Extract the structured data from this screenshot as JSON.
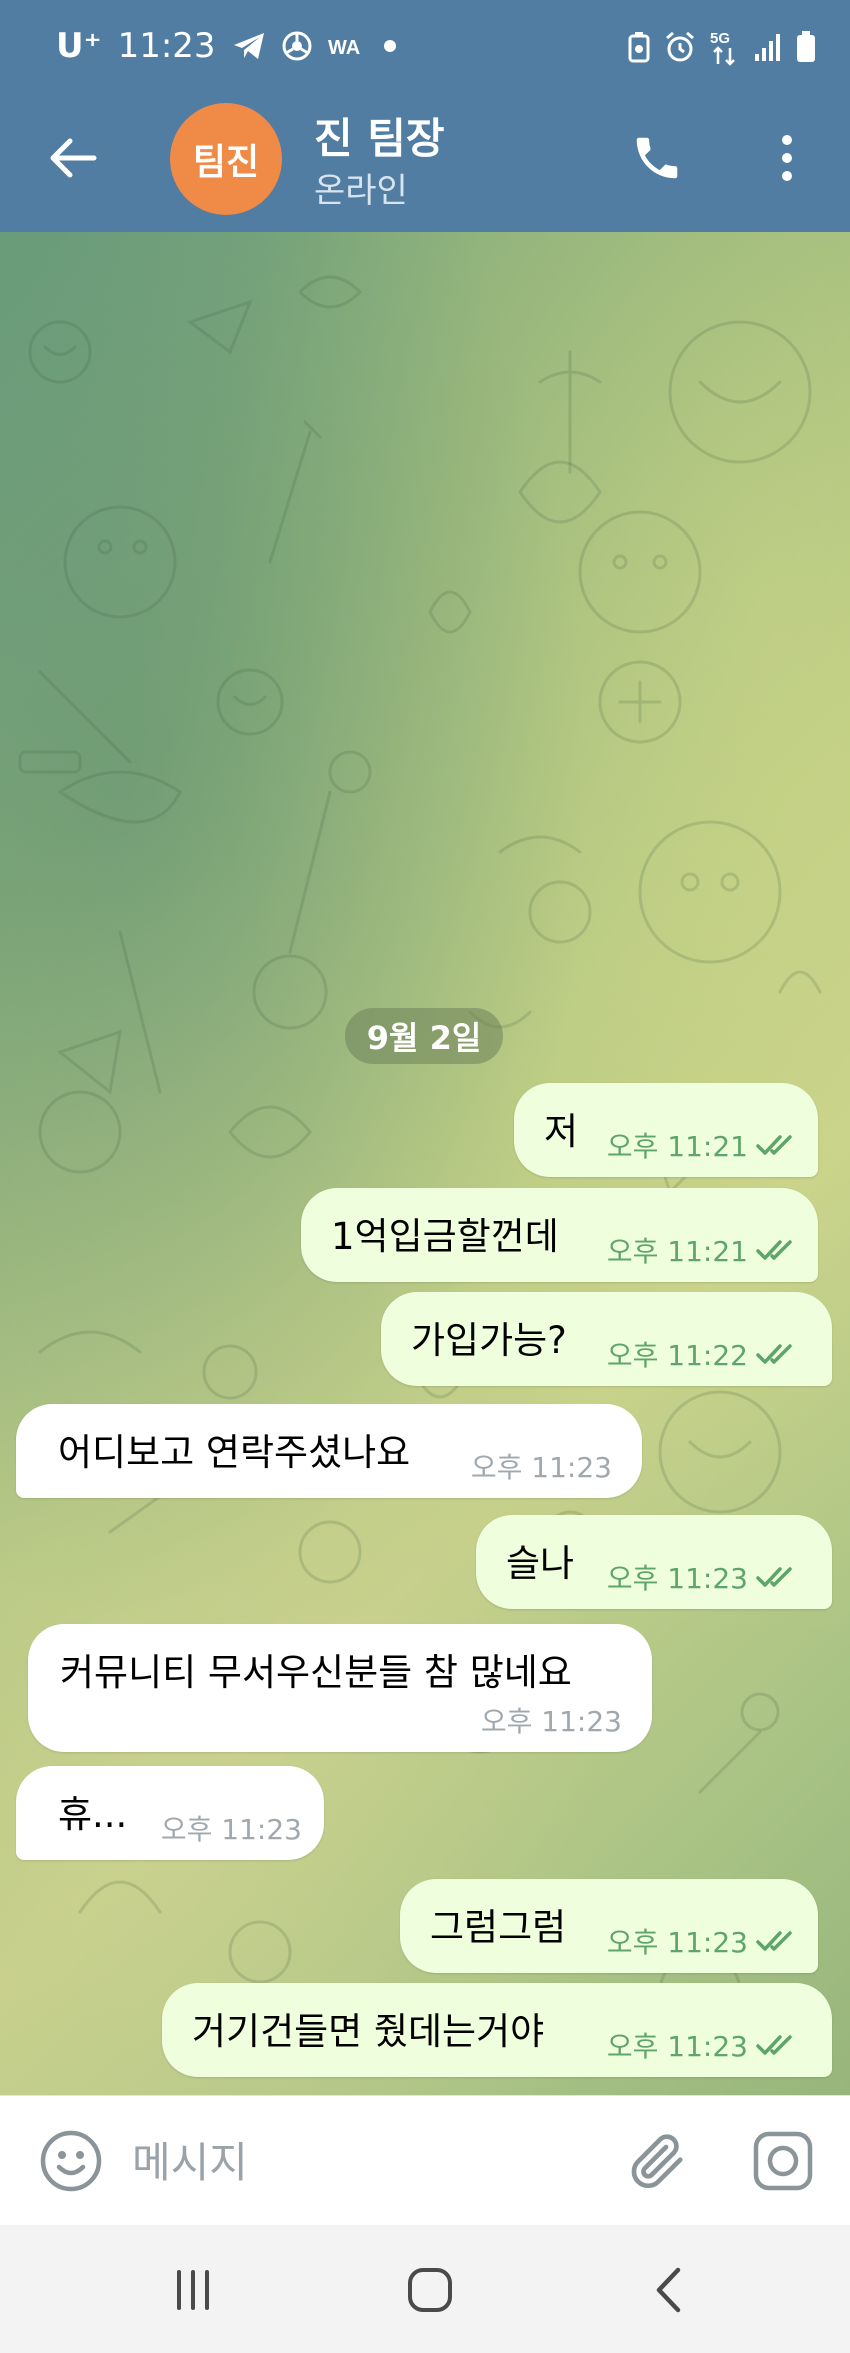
{
  "status_bar": {
    "carrier": "U⁺",
    "time": "11:23",
    "left_icons": [
      "telegram-icon",
      "chrome-icon",
      "wa-icon",
      "dot-icon"
    ],
    "right_icons": [
      "battery-saver-icon",
      "alarm-icon",
      "5g-icon",
      "signal-icon",
      "battery-icon"
    ],
    "network": "5G"
  },
  "header": {
    "avatar_text": "팀진",
    "title": "진 팀장",
    "status": "온라인",
    "colors": {
      "bar": "#517da2",
      "avatar": "#ef8a47"
    }
  },
  "chat": {
    "date_label": "9월 2일",
    "messages": [
      {
        "direction": "out",
        "text": "저",
        "time": "오후 11:21",
        "read": true
      },
      {
        "direction": "out",
        "text": "1억입금할껀데",
        "time": "오후 11:21",
        "read": true
      },
      {
        "direction": "out",
        "text": "가입가능?",
        "time": "오후 11:22",
        "read": true
      },
      {
        "direction": "in",
        "text": "어디보고 연락주셨나요",
        "time": "오후 11:23"
      },
      {
        "direction": "out",
        "text": "슬나",
        "time": "오후 11:23",
        "read": true
      },
      {
        "direction": "in",
        "text": "커뮤니티 무서우신분들 참 많네요",
        "time": "오후 11:23"
      },
      {
        "direction": "in",
        "text": "휴...",
        "time": "오후 11:23"
      },
      {
        "direction": "out",
        "text": "그럼그럼",
        "time": "오후 11:23",
        "read": true
      },
      {
        "direction": "out",
        "text": "거기건들면 줬데는거야",
        "time": "오후 11:23",
        "read": true
      }
    ],
    "colors": {
      "outgoing_bubble": "#effedd",
      "incoming_bubble": "#ffffff",
      "outgoing_meta": "#5fa56b",
      "incoming_meta": "#a0a8ae"
    }
  },
  "input": {
    "placeholder": "메시지",
    "value": ""
  },
  "icons": {
    "back": "arrow-left-icon",
    "call": "phone-icon",
    "menu": "more-vertical-icon",
    "emoji": "smile-icon",
    "attach": "paperclip-icon",
    "camera": "camera-icon",
    "read_receipt": "double-check-icon"
  },
  "nav": [
    "recent-apps-icon",
    "home-icon",
    "back-icon"
  ]
}
